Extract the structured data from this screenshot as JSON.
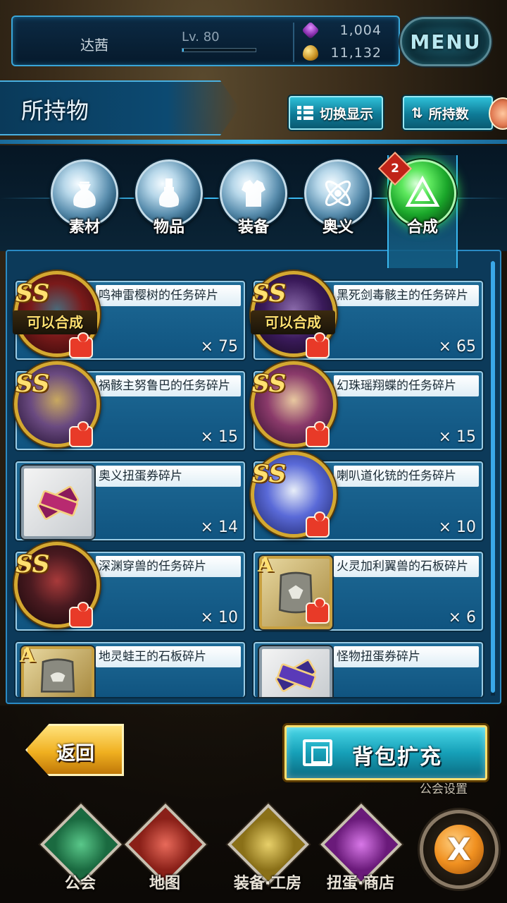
{
  "status": {
    "player_name": "达茜",
    "level_label": "Lv. 80",
    "level_progress": 0.02,
    "gems": "1,004",
    "coins": "11,132",
    "menu_label": "MENU"
  },
  "header": {
    "title": "所持物",
    "toggle_label": "切换显示",
    "sort_label": "所持数"
  },
  "tabs": [
    {
      "label": "素材",
      "active": false
    },
    {
      "label": "物品",
      "active": false
    },
    {
      "label": "装备",
      "active": false
    },
    {
      "label": "奥义",
      "active": false
    },
    {
      "label": "合成",
      "active": true,
      "badge": "2"
    }
  ],
  "items": [
    {
      "name": "鸣神雷樱树的任务碎片",
      "qty": "× 75",
      "rank": "SS",
      "tag": "可以合成",
      "icon": "red-creature-portrait"
    },
    {
      "name": "黑死剑毒骸主的任务碎片",
      "qty": "× 65",
      "rank": "SS",
      "tag": "可以合成",
      "icon": "purple-dragon-portrait"
    },
    {
      "name": "祸骸主努鲁巴的任务碎片",
      "qty": "× 15",
      "rank": "SS",
      "tag": "",
      "icon": "golden-skull-portrait"
    },
    {
      "name": "幻珠瑶翔蝶的任务碎片",
      "qty": "× 15",
      "rank": "SS",
      "tag": "",
      "icon": "butterfly-portrait"
    },
    {
      "name": "奥义扭蛋券碎片",
      "qty": "× 14",
      "rank": "",
      "tag": "",
      "icon": "ticket-icon"
    },
    {
      "name": "喇叭道化铳的任务碎片",
      "qty": "× 10",
      "rank": "SS",
      "tag": "",
      "icon": "jester-portrait"
    },
    {
      "name": "深渊穿兽的任务碎片",
      "qty": "× 10",
      "rank": "SS",
      "tag": "",
      "icon": "abyss-beast-portrait"
    },
    {
      "name": "火灵加利翼兽的石板碎片",
      "qty": "× 6",
      "rank": "A",
      "tag": "",
      "icon": "stone-tablet-icon"
    },
    {
      "name": "地灵蛙王的石板碎片",
      "qty": "",
      "rank": "A",
      "tag": "",
      "icon": "stone-tablet-icon"
    },
    {
      "name": "怪物扭蛋券碎片",
      "qty": "",
      "rank": "",
      "tag": "",
      "icon": "ticket-icon"
    }
  ],
  "footer": {
    "back_label": "返回",
    "expand_label": "背包扩充",
    "guild_setting": "公会设置",
    "nav": [
      "公会",
      "地图",
      "装备·工房",
      "扭蛋·商店"
    ],
    "close_icon": "X"
  },
  "colors": {
    "accent": "#3ab8f0",
    "active_tab": "#1aa62a",
    "rank_gold": "#ffe070",
    "puzzle_red": "#e83a28"
  }
}
